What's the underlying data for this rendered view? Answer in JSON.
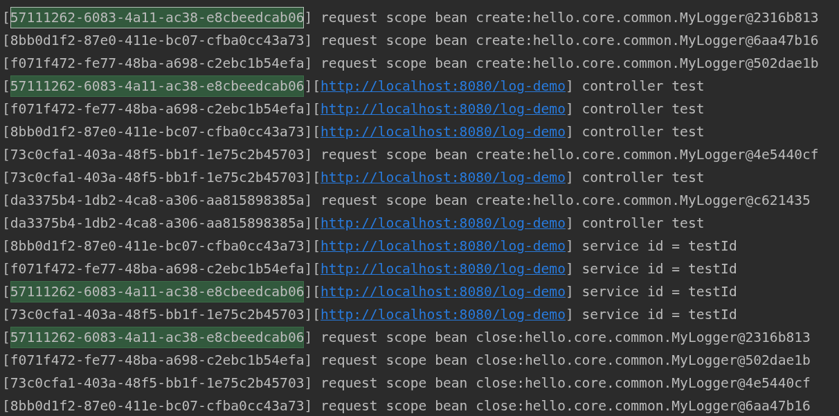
{
  "console_lines": [
    {
      "parts": [
        {
          "kind": "text",
          "text": "["
        },
        {
          "kind": "match",
          "text": "57111262-6083-4a11-ac38-e8cbeedcab06",
          "current": true
        },
        {
          "kind": "text",
          "text": "] request scope bean create:hello.core.common.MyLogger@2316b813"
        }
      ]
    },
    {
      "parts": [
        {
          "kind": "text",
          "text": "[8bb0d1f2-87e0-411e-bc07-cfba0cc43a73] request scope bean create:hello.core.common.MyLogger@6aa47b16"
        }
      ]
    },
    {
      "parts": [
        {
          "kind": "text",
          "text": "[f071f472-fe77-48ba-a698-c2ebc1b54efa] request scope bean create:hello.core.common.MyLogger@502dae1b"
        }
      ]
    },
    {
      "parts": [
        {
          "kind": "text",
          "text": "["
        },
        {
          "kind": "match",
          "text": "57111262-6083-4a11-ac38-e8cbeedcab06",
          "current": false
        },
        {
          "kind": "text",
          "text": "]["
        },
        {
          "kind": "link",
          "text": "http://localhost:8080/log-demo"
        },
        {
          "kind": "text",
          "text": "] controller test"
        }
      ]
    },
    {
      "parts": [
        {
          "kind": "text",
          "text": "[f071f472-fe77-48ba-a698-c2ebc1b54efa]["
        },
        {
          "kind": "link",
          "text": "http://localhost:8080/log-demo"
        },
        {
          "kind": "text",
          "text": "] controller test"
        }
      ]
    },
    {
      "parts": [
        {
          "kind": "text",
          "text": "[8bb0d1f2-87e0-411e-bc07-cfba0cc43a73]["
        },
        {
          "kind": "link",
          "text": "http://localhost:8080/log-demo"
        },
        {
          "kind": "text",
          "text": "] controller test"
        }
      ]
    },
    {
      "parts": [
        {
          "kind": "text",
          "text": "[73c0cfa1-403a-48f5-bb1f-1e75c2b45703] request scope bean create:hello.core.common.MyLogger@4e5440cf"
        }
      ]
    },
    {
      "parts": [
        {
          "kind": "text",
          "text": "[73c0cfa1-403a-48f5-bb1f-1e75c2b45703]["
        },
        {
          "kind": "link",
          "text": "http://localhost:8080/log-demo"
        },
        {
          "kind": "text",
          "text": "] controller test"
        }
      ]
    },
    {
      "parts": [
        {
          "kind": "text",
          "text": "[da3375b4-1db2-4ca8-a306-aa815898385a] request scope bean create:hello.core.common.MyLogger@c621435"
        }
      ]
    },
    {
      "parts": [
        {
          "kind": "text",
          "text": "[da3375b4-1db2-4ca8-a306-aa815898385a]["
        },
        {
          "kind": "link",
          "text": "http://localhost:8080/log-demo"
        },
        {
          "kind": "text",
          "text": "] controller test"
        }
      ]
    },
    {
      "parts": [
        {
          "kind": "text",
          "text": "[8bb0d1f2-87e0-411e-bc07-cfba0cc43a73]["
        },
        {
          "kind": "link",
          "text": "http://localhost:8080/log-demo"
        },
        {
          "kind": "text",
          "text": "] service id = testId"
        }
      ]
    },
    {
      "parts": [
        {
          "kind": "text",
          "text": "[f071f472-fe77-48ba-a698-c2ebc1b54efa]["
        },
        {
          "kind": "link",
          "text": "http://localhost:8080/log-demo"
        },
        {
          "kind": "text",
          "text": "] service id = testId"
        }
      ]
    },
    {
      "parts": [
        {
          "kind": "text",
          "text": "["
        },
        {
          "kind": "match",
          "text": "57111262-6083-4a11-ac38-e8cbeedcab06",
          "current": false
        },
        {
          "kind": "text",
          "text": "]["
        },
        {
          "kind": "link",
          "text": "http://localhost:8080/log-demo"
        },
        {
          "kind": "text",
          "text": "] service id = testId"
        }
      ]
    },
    {
      "parts": [
        {
          "kind": "text",
          "text": "[73c0cfa1-403a-48f5-bb1f-1e75c2b45703]["
        },
        {
          "kind": "link",
          "text": "http://localhost:8080/log-demo"
        },
        {
          "kind": "text",
          "text": "] service id = testId"
        }
      ]
    },
    {
      "parts": [
        {
          "kind": "text",
          "text": "["
        },
        {
          "kind": "match",
          "text": "57111262-6083-4a11-ac38-e8cbeedcab06",
          "current": false
        },
        {
          "kind": "text",
          "text": "] request scope bean close:hello.core.common.MyLogger@2316b813"
        }
      ]
    },
    {
      "parts": [
        {
          "kind": "text",
          "text": "[f071f472-fe77-48ba-a698-c2ebc1b54efa] request scope bean close:hello.core.common.MyLogger@502dae1b"
        }
      ]
    },
    {
      "parts": [
        {
          "kind": "text",
          "text": "[73c0cfa1-403a-48f5-bb1f-1e75c2b45703] request scope bean close:hello.core.common.MyLogger@4e5440cf"
        }
      ]
    },
    {
      "parts": [
        {
          "kind": "text",
          "text": "[8bb0d1f2-87e0-411e-bc07-cfba0cc43a73] request scope bean close:hello.core.common.MyLogger@6aa47b16"
        }
      ]
    }
  ]
}
